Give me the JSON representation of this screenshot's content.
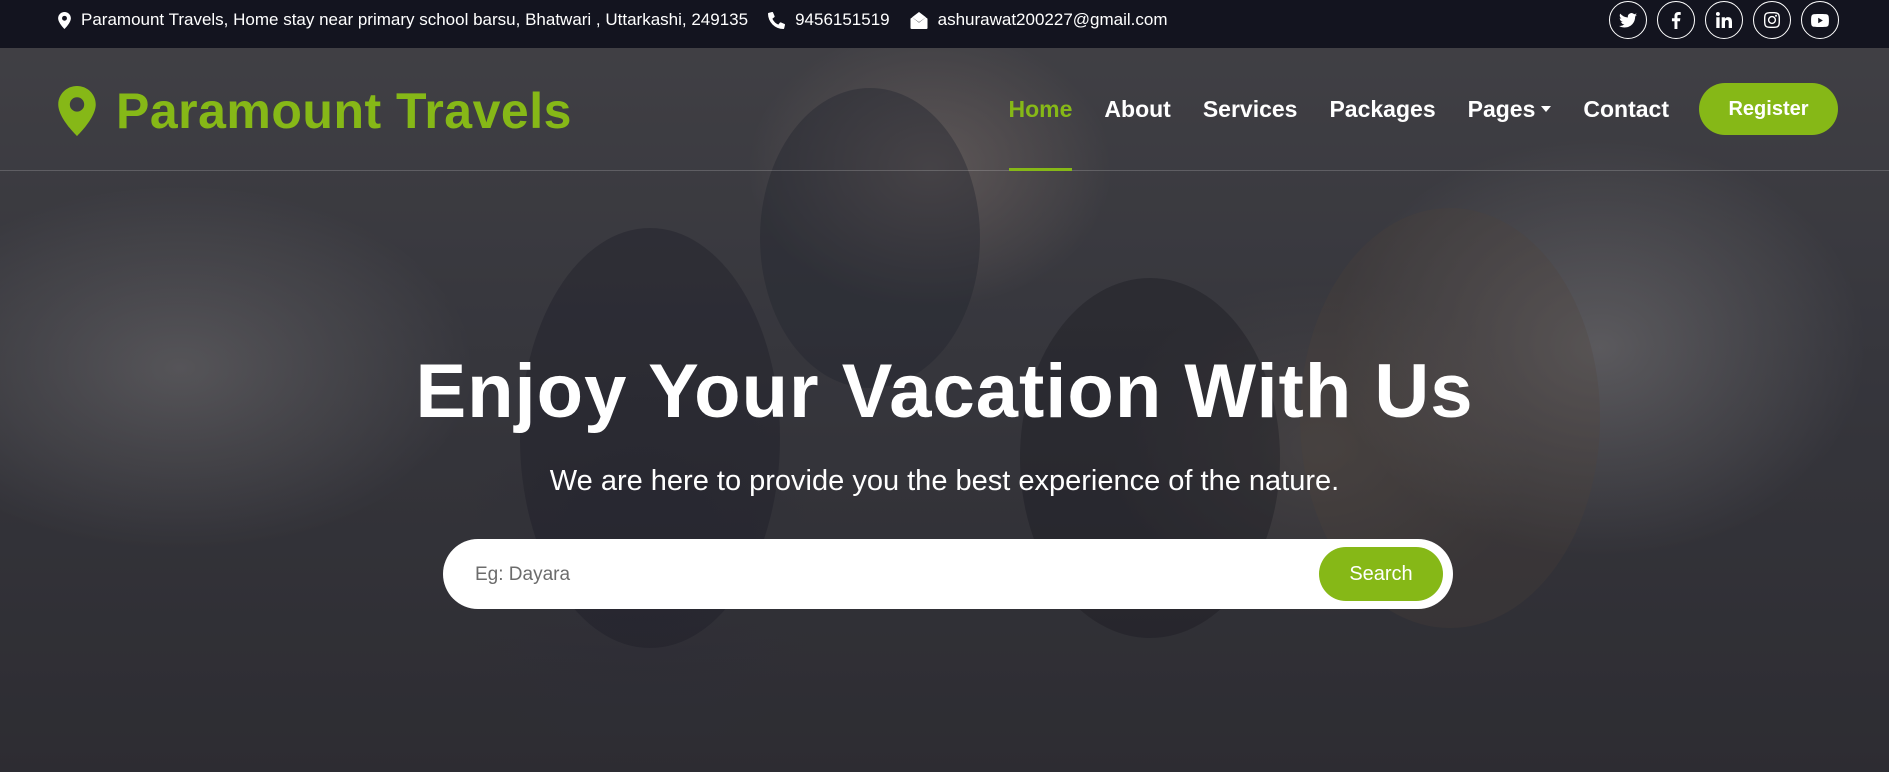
{
  "topbar": {
    "address": "Paramount Travels, Home stay near primary school barsu, Bhatwari , Uttarkashi, 249135",
    "phone": "9456151519",
    "email": "ashurawat200227@gmail.com",
    "socials": [
      "twitter-icon",
      "facebook-icon",
      "linkedin-icon",
      "instagram-icon",
      "youtube-icon"
    ]
  },
  "nav": {
    "brand": "Paramount Travels",
    "items": [
      {
        "label": "Home",
        "active": true
      },
      {
        "label": "About"
      },
      {
        "label": "Services"
      },
      {
        "label": "Packages"
      },
      {
        "label": "Pages",
        "dropdown": true
      },
      {
        "label": "Contact"
      }
    ],
    "register": "Register"
  },
  "hero": {
    "title": "Enjoy Your Vacation With Us",
    "subtitle": "We are here to provide you the best experience of the nature.",
    "search_placeholder": "Eg: Dayara",
    "search_button": "Search"
  },
  "colors": {
    "accent": "#86b817",
    "topbar_bg": "#13141f"
  }
}
